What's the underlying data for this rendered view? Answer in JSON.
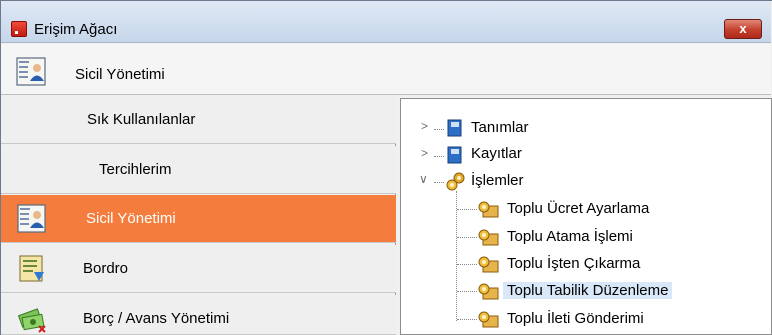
{
  "window": {
    "title": "Erişim Ağacı",
    "close_label": "x"
  },
  "header": {
    "title": "Sicil Yönetimi"
  },
  "nav": {
    "items": [
      {
        "label": "Sık Kullanılanlar",
        "icon": "none",
        "active": false
      },
      {
        "label": "Tercihlerim",
        "icon": "none",
        "active": false
      },
      {
        "label": "Sicil Yönetimi",
        "icon": "id-card-icon",
        "active": true
      },
      {
        "label": "Bordro",
        "icon": "payroll-book-icon",
        "active": false
      },
      {
        "label": "Borç / Avans Yönetimi",
        "icon": "money-icon",
        "active": false
      }
    ]
  },
  "tree": {
    "nodes": [
      {
        "label": "Tanımlar",
        "icon": "book-icon",
        "expanded": false
      },
      {
        "label": "Kayıtlar",
        "icon": "book-icon",
        "expanded": false
      },
      {
        "label": "İşlemler",
        "icon": "gears-icon",
        "expanded": true
      },
      {
        "label": "Toplu Ücret Ayarlama",
        "icon": "gear-box-icon"
      },
      {
        "label": "Toplu Atama İşlemi",
        "icon": "gear-box-icon"
      },
      {
        "label": "Toplu İşten Çıkarma",
        "icon": "gear-box-icon"
      },
      {
        "label": "Toplu Tabilik Düzenleme",
        "icon": "gear-box-icon",
        "selected": true
      },
      {
        "label": "Toplu İleti Gönderimi",
        "icon": "gear-box-icon"
      }
    ]
  },
  "colors": {
    "active_nav": "#f47c3c",
    "selection": "#d9e8f8",
    "close_button": "#c4402b"
  }
}
